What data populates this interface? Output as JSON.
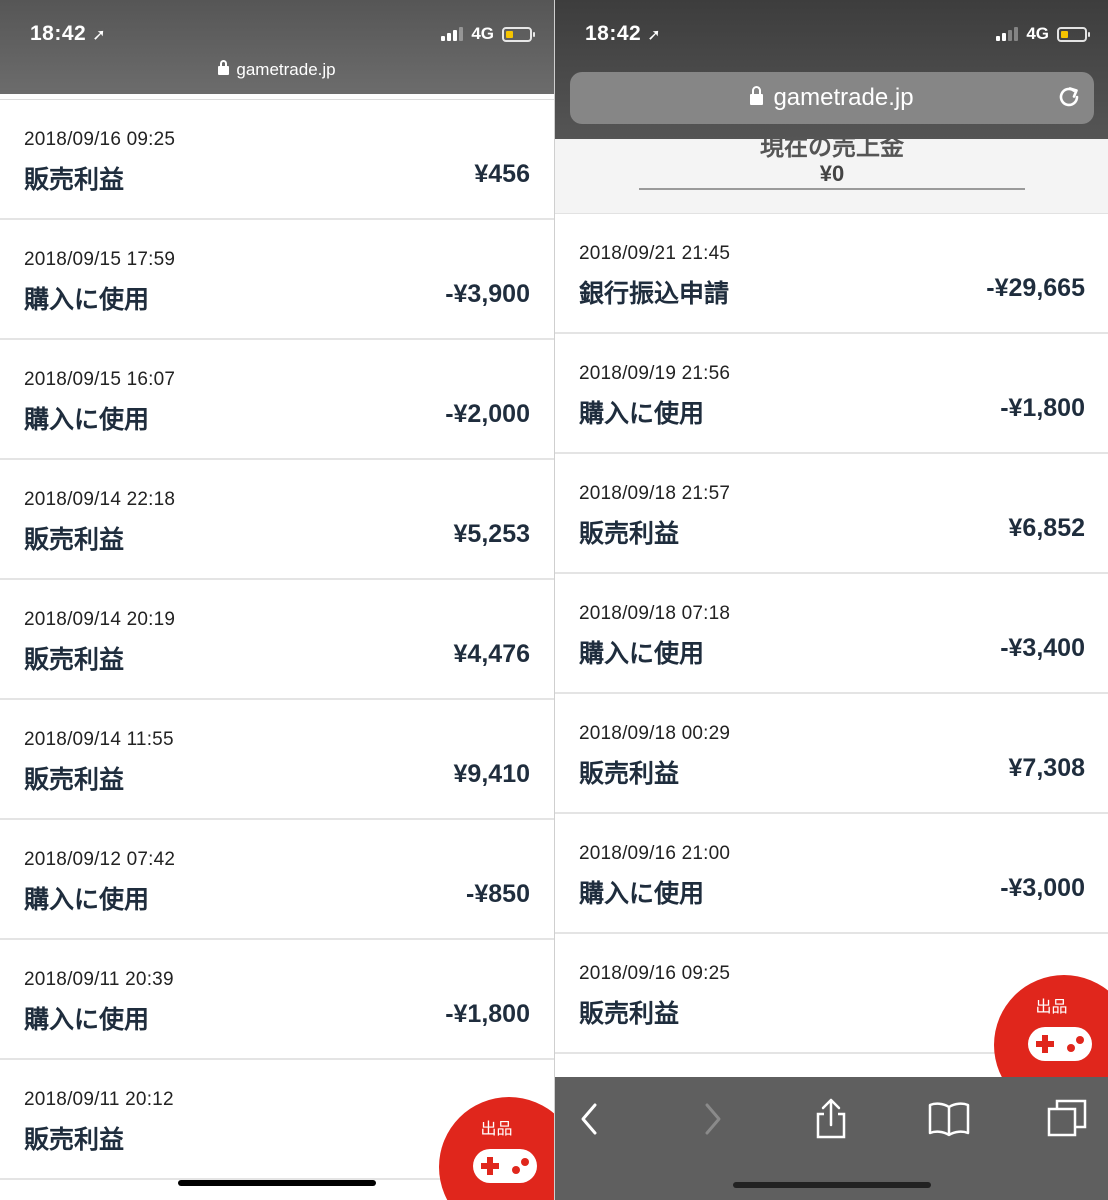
{
  "status": {
    "time": "18:42",
    "network": "4G"
  },
  "left": {
    "url": "gametrade.jp",
    "transactions": [
      {
        "datetime": "2018/09/16 09:25",
        "label": "販売利益",
        "amount": "¥456"
      },
      {
        "datetime": "2018/09/15 17:59",
        "label": "購入に使用",
        "amount": "-¥3,900"
      },
      {
        "datetime": "2018/09/15 16:07",
        "label": "購入に使用",
        "amount": "-¥2,000"
      },
      {
        "datetime": "2018/09/14 22:18",
        "label": "販売利益",
        "amount": "¥5,253"
      },
      {
        "datetime": "2018/09/14 20:19",
        "label": "販売利益",
        "amount": "¥4,476"
      },
      {
        "datetime": "2018/09/14 11:55",
        "label": "販売利益",
        "amount": "¥9,410"
      },
      {
        "datetime": "2018/09/12 07:42",
        "label": "購入に使用",
        "amount": "-¥850"
      },
      {
        "datetime": "2018/09/11 20:39",
        "label": "購入に使用",
        "amount": "-¥1,800"
      },
      {
        "datetime": "2018/09/11 20:12",
        "label": "販売利益",
        "amount": ""
      }
    ],
    "fab_label": "出品"
  },
  "right": {
    "url": "gametrade.jp",
    "balance_title": "現在の売上金",
    "balance_value": "¥0",
    "transactions": [
      {
        "datetime": "2018/09/21 21:45",
        "label": "銀行振込申請",
        "amount": "-¥29,665"
      },
      {
        "datetime": "2018/09/19 21:56",
        "label": "購入に使用",
        "amount": "-¥1,800"
      },
      {
        "datetime": "2018/09/18 21:57",
        "label": "販売利益",
        "amount": "¥6,852"
      },
      {
        "datetime": "2018/09/18 07:18",
        "label": "購入に使用",
        "amount": "-¥3,400"
      },
      {
        "datetime": "2018/09/18 00:29",
        "label": "販売利益",
        "amount": "¥7,308"
      },
      {
        "datetime": "2018/09/16 21:00",
        "label": "購入に使用",
        "amount": "-¥3,000"
      },
      {
        "datetime": "2018/09/16 09:25",
        "label": "販売利益",
        "amount": ""
      }
    ],
    "fab_label": "出品"
  },
  "icons": {
    "location": "location-arrow-icon",
    "lock": "lock-icon",
    "reload": "reload-icon",
    "back": "back-chevron-icon",
    "forward": "forward-chevron-icon",
    "share": "share-icon",
    "bookmarks": "bookmarks-icon",
    "tabs": "tabs-icon",
    "controller": "gamepad-icon"
  },
  "colors": {
    "accent": "#e0261c",
    "text": "#1f2d3d",
    "battery": "#f5c400"
  }
}
